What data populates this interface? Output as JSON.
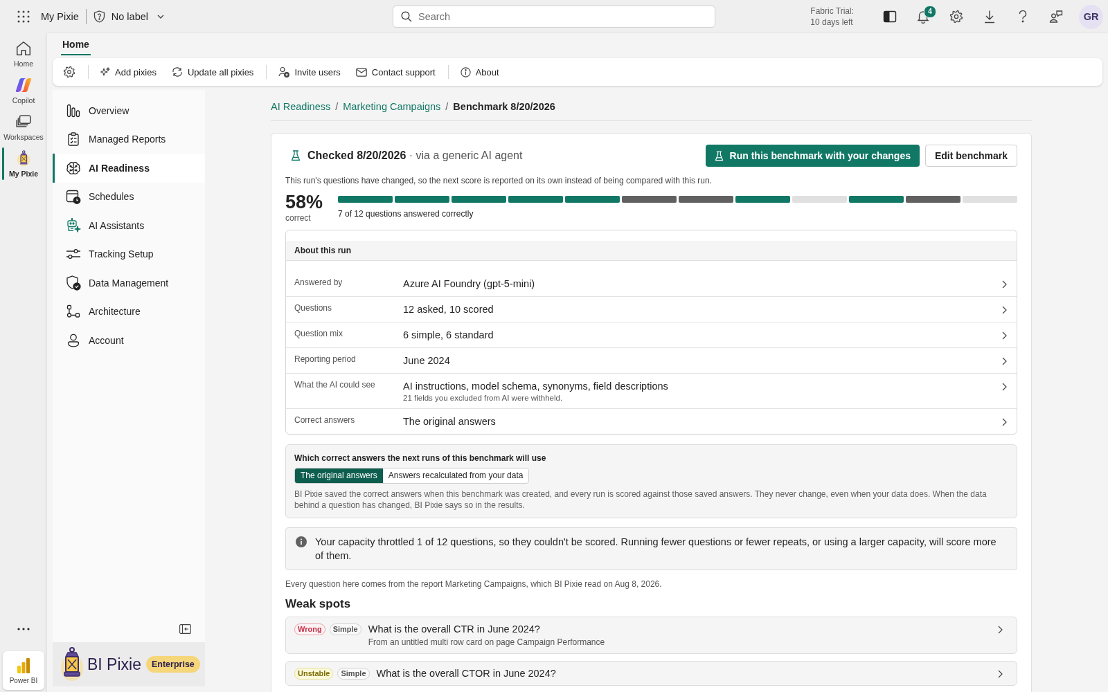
{
  "top_bar": {
    "app_name": "My Pixie",
    "sensitivity_label": "No label",
    "search": {
      "placeholder": "Search"
    },
    "trial_notice": [
      "Fabric Trial:",
      "10 days left"
    ],
    "notification_count": "4",
    "avatar_initials": "GR"
  },
  "app_rail": {
    "items": [
      {
        "label": "Home",
        "selected": false
      },
      {
        "label": "Copilot",
        "selected": false
      },
      {
        "label": "Workspaces",
        "selected": false
      },
      {
        "label": "My Pixie",
        "selected": true
      }
    ],
    "footer_app": "Power BI"
  },
  "tabs": [
    {
      "label": "Home",
      "selected": true
    }
  ],
  "toolbar": {
    "groups": [
      [
        {
          "label": "Add pixies"
        },
        {
          "label": "Update all pixies"
        }
      ],
      [
        {
          "label": "Invite users"
        },
        {
          "label": "Contact support"
        }
      ],
      [
        {
          "label": "About"
        }
      ]
    ]
  },
  "sidebar": {
    "items": [
      {
        "label": "Overview",
        "selected": false
      },
      {
        "label": "Managed Reports",
        "selected": false
      },
      {
        "label": "AI Readiness",
        "selected": true
      },
      {
        "label": "Schedules",
        "selected": false
      },
      {
        "label": "AI Assistants",
        "selected": false
      },
      {
        "label": "Tracking Setup",
        "selected": false
      },
      {
        "label": "Data Management",
        "selected": false
      },
      {
        "label": "Architecture",
        "selected": false
      },
      {
        "label": "Account",
        "selected": false
      }
    ],
    "brand": {
      "name": "BI Pixie",
      "edition": "Enterprise"
    }
  },
  "breadcrumb": [
    {
      "label": "AI Readiness",
      "kind": "link",
      "separator": "/"
    },
    {
      "label": "Marketing Campaigns",
      "kind": "link",
      "separator": "/"
    },
    {
      "label": "Benchmark 8/20/2026",
      "kind": "current"
    }
  ],
  "benchmark": {
    "heading": "**Checked 8/20/2026** · via a generic AI agent",
    "actions": [
      {
        "label": "Run this benchmark with your changes",
        "kind": "primary"
      },
      {
        "label": "Edit benchmark",
        "kind": "secondary"
      }
    ],
    "note": "This run's questions have changed, so the next score is reported on its own instead of being compared with this run.",
    "score": {
      "value": "58%",
      "caption": "correct",
      "summary": "7 of 12 questions answered correctly",
      "questions": [
        {
          "kind": "correct"
        },
        {
          "kind": "correct"
        },
        {
          "kind": "correct"
        },
        {
          "kind": "correct"
        },
        {
          "kind": "correct"
        },
        {
          "kind": "wrong"
        },
        {
          "kind": "wrong"
        },
        {
          "kind": "correct"
        },
        {
          "kind": "unscored"
        },
        {
          "kind": "correct"
        },
        {
          "kind": "wrong"
        },
        {
          "kind": "unscored"
        }
      ]
    }
  },
  "about_run": {
    "title": "About this run",
    "rows": [
      {
        "label": "Answered by",
        "value": "Azure AI Foundry (gpt-5-mini)"
      },
      {
        "label": "Questions",
        "value": "12 asked, 10 scored"
      },
      {
        "label": "Question mix",
        "value": "6 simple, 6 standard"
      },
      {
        "label": "Reporting period",
        "value": "June 2024"
      },
      {
        "label": "What the AI could see",
        "value": "AI instructions, model schema, synonyms, field descriptions",
        "detail": "21 fields you excluded from AI were withheld."
      },
      {
        "label": "Correct answers",
        "value": "The original answers"
      }
    ]
  },
  "answer_source": {
    "title": "Which correct answers the next runs of this benchmark will use",
    "options": [
      {
        "label": "The original answers",
        "selected": true
      },
      {
        "label": "Answers recalculated from your data",
        "selected": false
      }
    ],
    "description": "BI Pixie saved the correct answers when this benchmark was created, and every run is scored against those saved answers. They never change, even when your data does. When the data behind a question has changed, BI Pixie says so in the results."
  },
  "notice": "Your capacity throttled 1 of 12 questions, so they couldn't be scored. Running fewer questions or fewer repeats, or using a larger capacity, will score more of them.",
  "source_note": "Every question here comes from the report Marketing Campaigns, which BI Pixie read on Aug 8, 2026.",
  "weak_spots": {
    "title": "Weak spots",
    "items": [
      {
        "status": "Wrong",
        "kind": "wrong",
        "difficulty": "Simple",
        "question": "What is the overall CTR in June 2024?",
        "origin": "From an untitled multi row card on page Campaign Performance"
      },
      {
        "status": "Unstable",
        "kind": "unstable",
        "difficulty": "Simple",
        "question": "What is the overall CTOR in June 2024?"
      }
    ]
  }
}
